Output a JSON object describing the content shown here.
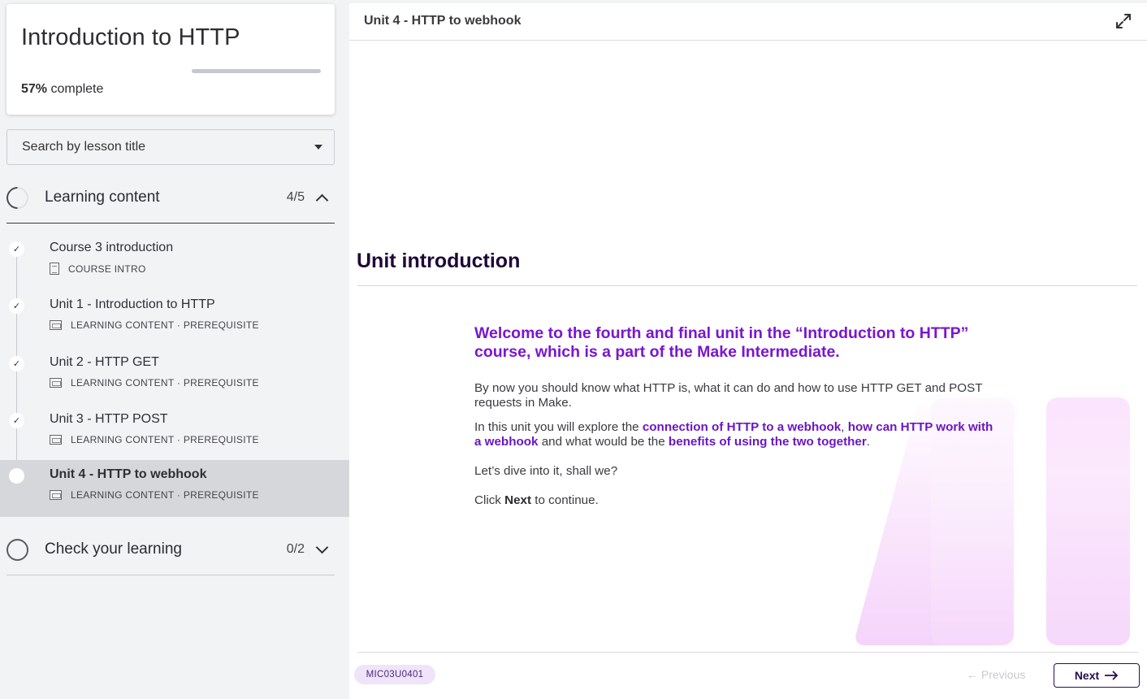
{
  "course": {
    "title": "Introduction to HTTP",
    "progress_percent": 57,
    "progress_percent_label": "57%",
    "progress_suffix": " complete"
  },
  "search": {
    "placeholder": "Search by lesson title"
  },
  "sections": [
    {
      "title": "Learning content",
      "count": "4/5",
      "expanded": true
    },
    {
      "title": "Check your learning",
      "count": "0/2",
      "expanded": false
    }
  ],
  "lessons": [
    {
      "title": "Course 3 introduction",
      "meta": "COURSE INTRO",
      "status": "✓",
      "type_icon": "document-icon"
    },
    {
      "title": "Unit 1 - Introduction to HTTP",
      "meta": "LEARNING CONTENT · PREREQUISITE",
      "status": "✓",
      "type_icon": "slides-icon"
    },
    {
      "title": "Unit 2 - HTTP GET",
      "meta": "LEARNING CONTENT · PREREQUISITE",
      "status": "✓",
      "type_icon": "slides-icon"
    },
    {
      "title": "Unit 3 - HTTP POST",
      "meta": "LEARNING CONTENT · PREREQUISITE",
      "status": "✓",
      "type_icon": "slides-icon"
    },
    {
      "title": "Unit 4 - HTTP to webhook",
      "meta": "LEARNING CONTENT · PREREQUISITE",
      "status": "",
      "type_icon": "slides-icon",
      "active": true
    }
  ],
  "main": {
    "header_title": "Unit 4 - HTTP to webhook",
    "heading": "Unit introduction",
    "lead": "Welcome to the fourth and final unit in the “Introduction to HTTP” course, which is a part of the Make Intermediate.",
    "p1": "By now you should know what HTTP is, what it can do and how to use HTTP GET and POST requests in Make.",
    "p2": {
      "t1": "In this unit you will explore the ",
      "h1": "connection of HTTP to a webhook",
      "t2": ", ",
      "h2": "how can HTTP work with a webhook",
      "t3": " and what would be the ",
      "h3": "benefits of using the two together",
      "t4": "."
    },
    "p3": "Let’s dive into it, shall we?",
    "p4": {
      "t1": "Click ",
      "b": "Next",
      "t2": " to continue."
    },
    "code": "MIC03U0401",
    "prev_label": "← Previous",
    "next_label": "Next"
  },
  "colors": {
    "accent": "#7a16cf",
    "brand_dark": "#2a0d4e",
    "active_row": "#d6d7da"
  }
}
